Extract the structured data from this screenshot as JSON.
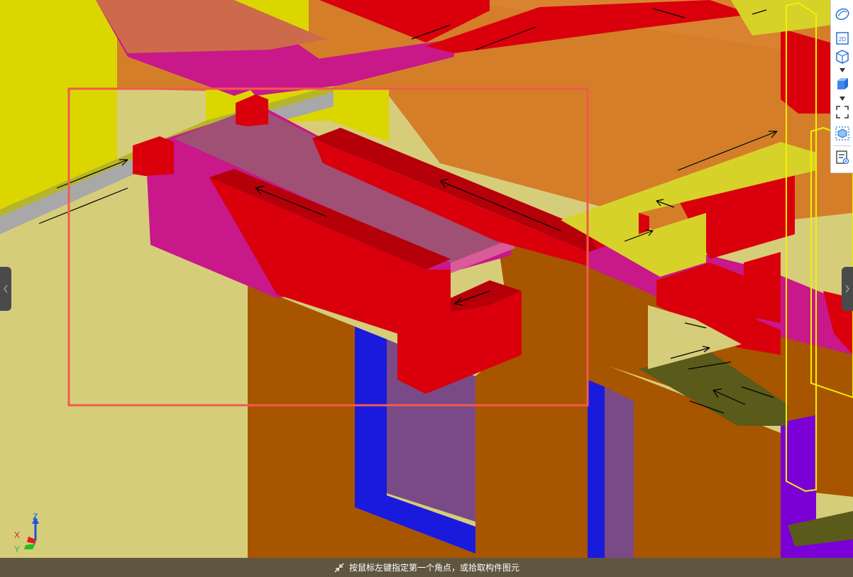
{
  "status": {
    "hint": "按鼠标左键指定第一个角点，或拾取构件图元",
    "icon": "pick-cursor-icon"
  },
  "axis": {
    "x_label": "X",
    "y_label": "Y",
    "z_label": "Z"
  },
  "toolbar": {
    "buttons": [
      {
        "name": "dynamic-observe-icon"
      },
      {
        "name": "view-2d-icon",
        "label": "2D"
      },
      {
        "name": "view-3d-icon"
      },
      {
        "name": "display-mode-icon"
      },
      {
        "name": "fullscreen-icon"
      },
      {
        "name": "element-display-icon"
      },
      {
        "name": "property-view-icon"
      }
    ]
  },
  "colors": {
    "selection_rect": "#f05a4e",
    "beam_red": "#d9000c",
    "beam_dark_red": "#b5000a",
    "slab_orange": "#d47e2a",
    "wall_brown": "#a85500",
    "yellow": "#d9d400",
    "magenta": "#c8188a",
    "blue": "#1a1adc",
    "purple": "#7a4a86"
  }
}
